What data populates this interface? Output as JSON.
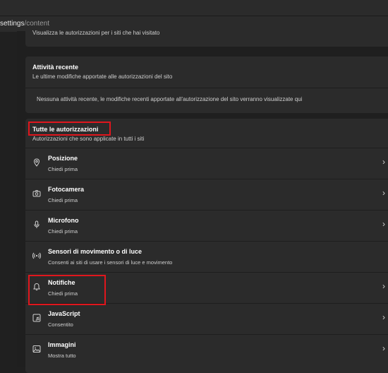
{
  "address": {
    "url_main": "settings",
    "url_rest": "/content"
  },
  "site_card": {
    "text": "Visualizza le autorizzazioni per i siti che hai visitato"
  },
  "recent": {
    "title": "Attività recente",
    "subtitle": "Le ultime modifiche apportate alle autorizzazioni del sito",
    "empty": "Nessuna attività recente, le modifiche recenti apportate all'autorizzazione del sito verranno visualizzate qui"
  },
  "all": {
    "title": "Tutte le autorizzazioni",
    "subtitle": "Autorizzazioni che sono applicate in tutti i siti",
    "items": [
      {
        "label": "Posizione",
        "sub": "Chiedi prima",
        "icon": "location-pin-icon"
      },
      {
        "label": "Fotocamera",
        "sub": "Chiedi prima",
        "icon": "camera-icon"
      },
      {
        "label": "Microfono",
        "sub": "Chiedi prima",
        "icon": "microphone-icon"
      },
      {
        "label": "Sensori di movimento o di luce",
        "sub": "Consenti ai siti di usare i sensori di luce e movimento",
        "icon": "sensor-icon"
      },
      {
        "label": "Notifiche",
        "sub": "Chiedi prima",
        "icon": "bell-icon"
      },
      {
        "label": "JavaScript",
        "sub": "Consentito",
        "icon": "javascript-icon"
      },
      {
        "label": "Immagini",
        "sub": "Mostra tutto",
        "icon": "image-icon"
      }
    ]
  },
  "colors": {
    "highlight": "#e0161d",
    "card": "#2b2b2b",
    "background": "#1f1f1f"
  }
}
